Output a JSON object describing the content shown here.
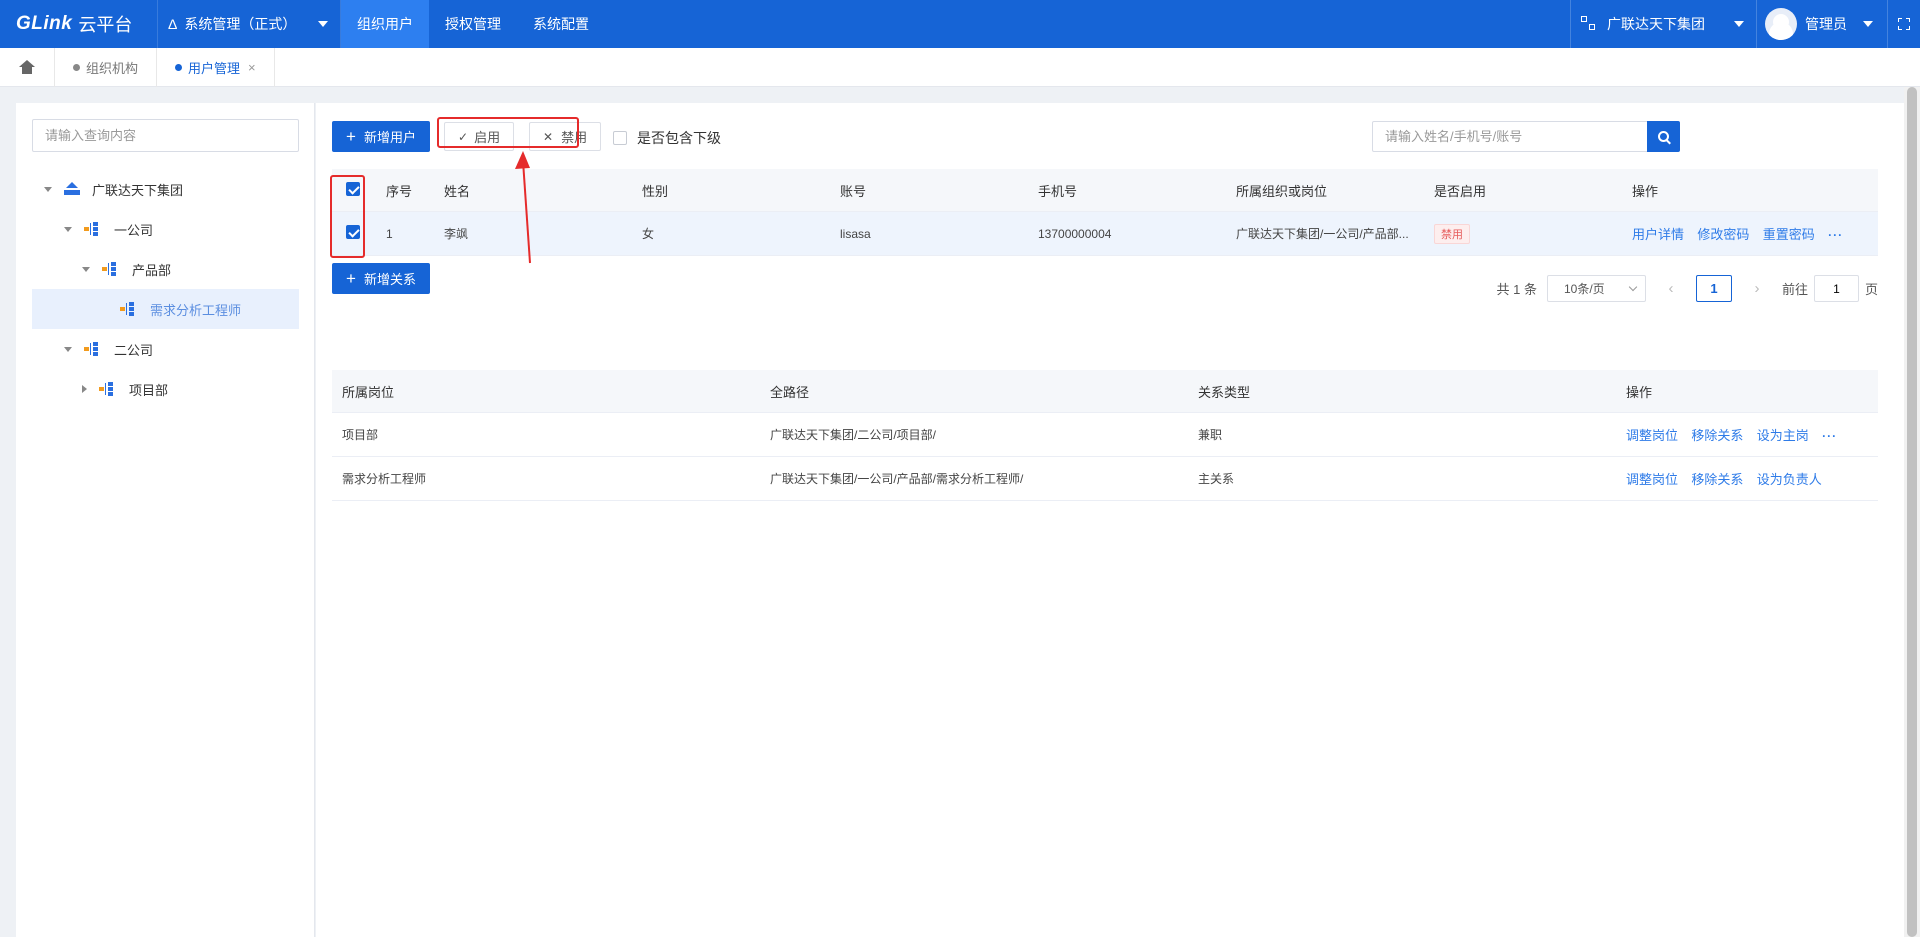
{
  "topbar": {
    "logo_brand": "GLink",
    "logo_suffix": "云平台",
    "system_label": "系统管理（正式）",
    "nav": [
      "组织用户",
      "授权管理",
      "系统配置"
    ],
    "org_switch": "广联达天下集团",
    "user_name": "管理员"
  },
  "tabs": {
    "items": [
      {
        "label": "组织机构",
        "active": false
      },
      {
        "label": "用户管理",
        "active": true
      }
    ],
    "close_glyph": "×"
  },
  "tree": {
    "search_placeholder": "请输入查询内容",
    "nodes": [
      {
        "label": "广联达天下集团",
        "type": "group",
        "level": 0,
        "expanded": true
      },
      {
        "label": "一公司",
        "type": "dept",
        "level": 1,
        "expanded": true
      },
      {
        "label": "产品部",
        "type": "dept",
        "level": 2,
        "expanded": true
      },
      {
        "label": "需求分析工程师",
        "type": "dept",
        "level": 3,
        "selected": true
      },
      {
        "label": "二公司",
        "type": "dept",
        "level": 1,
        "expanded": true
      },
      {
        "label": "项目部",
        "type": "dept",
        "level": 2,
        "expanded": false
      }
    ]
  },
  "toolbar": {
    "add_user": "新增用户",
    "enable": "启用",
    "disable": "禁用",
    "include_sub": "是否包含下级",
    "search_placeholder": "请输入姓名/手机号/账号"
  },
  "user_table": {
    "headers": [
      "序号",
      "姓名",
      "性别",
      "账号",
      "手机号",
      "所属组织或岗位",
      "是否启用",
      "操作"
    ],
    "rows": [
      {
        "index": "1",
        "name": "李飒",
        "gender": "女",
        "account": "lisasa",
        "phone": "13700000004",
        "org": "广联达天下集团/一公司/产品部...",
        "status": "禁用",
        "actions": [
          "用户详情",
          "修改密码",
          "重置密码"
        ],
        "more": "···"
      }
    ]
  },
  "pager": {
    "total": "共 1 条",
    "page_size": "10条/页",
    "prev": "‹",
    "current": "1",
    "next": "›",
    "goto_label": "前往",
    "goto_value": "1",
    "page_unit": "页"
  },
  "relation": {
    "add_button": "新增关系",
    "headers": [
      "所属岗位",
      "全路径",
      "关系类型",
      "操作"
    ],
    "rows": [
      {
        "post": "项目部",
        "path": "广联达天下集团/二公司/项目部/",
        "type": "兼职",
        "actions": [
          "调整岗位",
          "移除关系",
          "设为主岗"
        ],
        "more": "···"
      },
      {
        "post": "需求分析工程师",
        "path": "广联达天下集团/一公司/产品部/需求分析工程师/",
        "type": "主关系",
        "actions": [
          "调整岗位",
          "移除关系",
          "设为负责人"
        ],
        "more": ""
      }
    ]
  },
  "colors": {
    "primary": "#1664d6",
    "annotation": "#e52b2b",
    "link": "#2e7be8",
    "disabled_badge": "#e65c5c"
  }
}
